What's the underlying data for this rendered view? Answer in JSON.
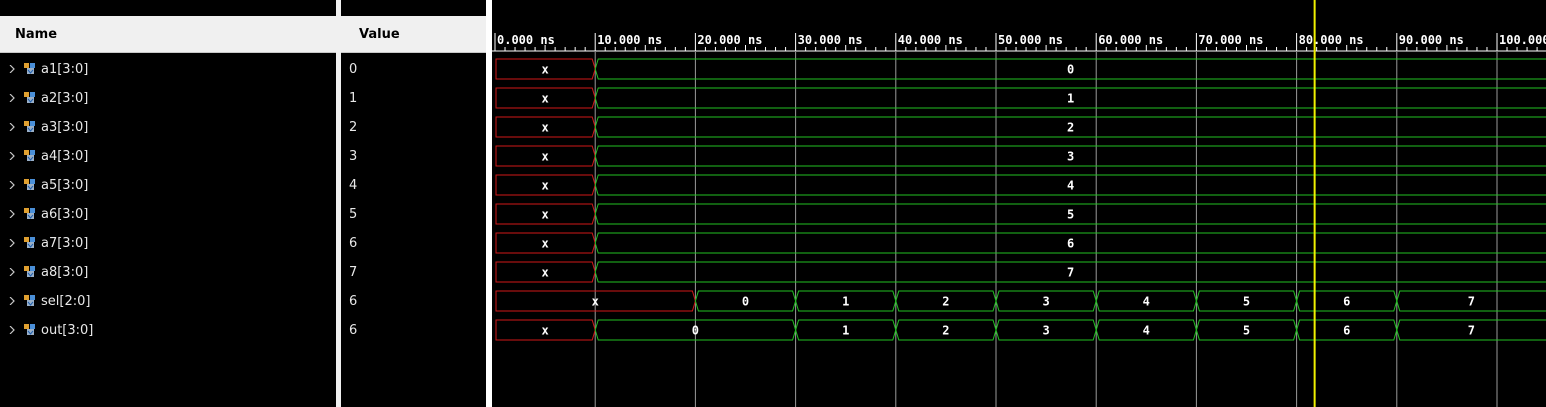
{
  "headers": {
    "name": "Name",
    "value": "Value"
  },
  "timeline": {
    "labels": [
      "0.000 ns",
      "10.000 ns",
      "20.000 ns",
      "30.000 ns",
      "40.000 ns",
      "50.000 ns",
      "60.000 ns",
      "70.000 ns",
      "80.000 ns",
      "90.000 ns",
      "100.000 ns"
    ],
    "cursor_ns": 81.8
  },
  "colors": {
    "valid": "#22c022",
    "unknown": "#d01818",
    "cursor": "#f0f000",
    "grid": "#9a9a9a"
  },
  "signals": [
    {
      "name": "a1[3:0]",
      "value": "0",
      "segments": [
        [
          "x",
          0,
          10
        ],
        [
          "0",
          10,
          105
        ]
      ]
    },
    {
      "name": "a2[3:0]",
      "value": "1",
      "segments": [
        [
          "x",
          0,
          10
        ],
        [
          "1",
          10,
          105
        ]
      ]
    },
    {
      "name": "a3[3:0]",
      "value": "2",
      "segments": [
        [
          "x",
          0,
          10
        ],
        [
          "2",
          10,
          105
        ]
      ]
    },
    {
      "name": "a4[3:0]",
      "value": "3",
      "segments": [
        [
          "x",
          0,
          10
        ],
        [
          "3",
          10,
          105
        ]
      ]
    },
    {
      "name": "a5[3:0]",
      "value": "4",
      "segments": [
        [
          "x",
          0,
          10
        ],
        [
          "4",
          10,
          105
        ]
      ]
    },
    {
      "name": "a6[3:0]",
      "value": "5",
      "segments": [
        [
          "x",
          0,
          10
        ],
        [
          "5",
          10,
          105
        ]
      ]
    },
    {
      "name": "a7[3:0]",
      "value": "6",
      "segments": [
        [
          "x",
          0,
          10
        ],
        [
          "6",
          10,
          105
        ]
      ]
    },
    {
      "name": "a8[3:0]",
      "value": "7",
      "segments": [
        [
          "x",
          0,
          10
        ],
        [
          "7",
          10,
          105
        ]
      ]
    },
    {
      "name": "sel[2:0]",
      "value": "6",
      "segments": [
        [
          "x",
          0,
          20
        ],
        [
          "0",
          20,
          30
        ],
        [
          "1",
          30,
          40
        ],
        [
          "2",
          40,
          50
        ],
        [
          "3",
          50,
          60
        ],
        [
          "4",
          60,
          70
        ],
        [
          "5",
          70,
          80
        ],
        [
          "6",
          80,
          90
        ],
        [
          "7",
          90,
          105
        ]
      ]
    },
    {
      "name": "out[3:0]",
      "value": "6",
      "segments": [
        [
          "x",
          0,
          10
        ],
        [
          "0",
          10,
          30
        ],
        [
          "1",
          30,
          40
        ],
        [
          "2",
          40,
          50
        ],
        [
          "3",
          50,
          60
        ],
        [
          "4",
          60,
          70
        ],
        [
          "5",
          70,
          80
        ],
        [
          "6",
          80,
          90
        ],
        [
          "7",
          90,
          105
        ]
      ]
    }
  ]
}
